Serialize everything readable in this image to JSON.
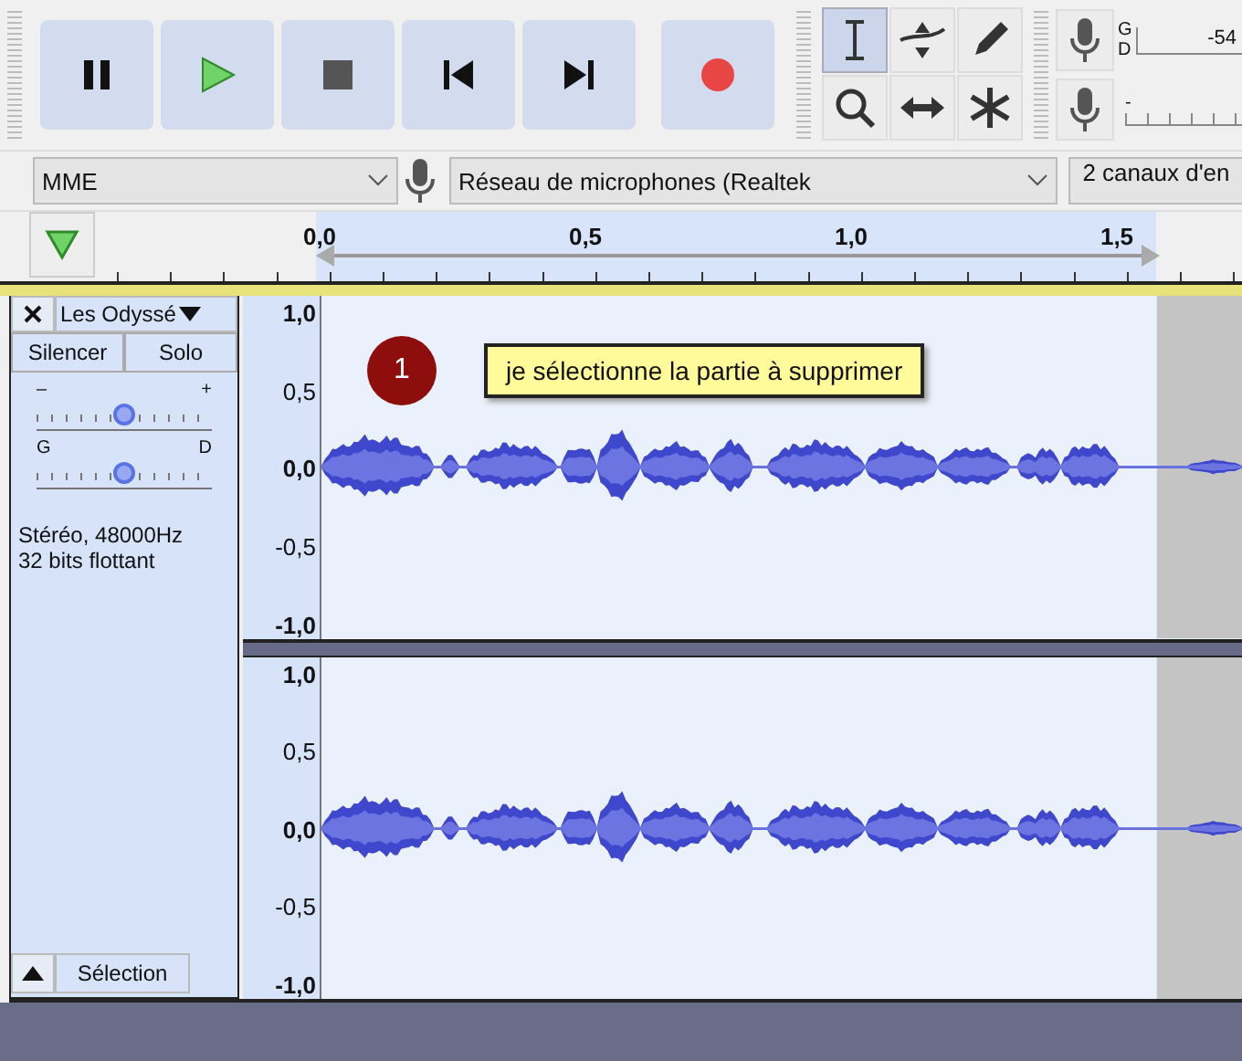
{
  "transport": [
    {
      "kind": "pause"
    },
    {
      "kind": "play"
    },
    {
      "kind": "stop"
    },
    {
      "kind": "skip_start"
    },
    {
      "kind": "skip_end"
    },
    {
      "kind": "record"
    }
  ],
  "tools": [
    {
      "kind": "select",
      "selected": true
    },
    {
      "kind": "envelope",
      "selected": false
    },
    {
      "kind": "draw",
      "selected": false
    },
    {
      "kind": "zoom",
      "selected": false
    },
    {
      "kind": "timeshift",
      "selected": false
    },
    {
      "kind": "multi",
      "selected": false
    }
  ],
  "record_meter": {
    "channel_labels": [
      "G",
      "D"
    ],
    "reading": "-54"
  },
  "play_meter": {
    "reading": "-"
  },
  "devices": {
    "host": "MME",
    "input": "Réseau de microphones (Realtek",
    "channels": "2 canaux d'en"
  },
  "timeline": {
    "labels": [
      "0,0",
      "0,5",
      "1,0",
      "1,5"
    ]
  },
  "track": {
    "name": "Les Odyssé",
    "mute": "Silencer",
    "solo": "Solo",
    "gain": {
      "min": "–",
      "max": "+",
      "level": 0.5
    },
    "pan": {
      "min": "G",
      "max": "D",
      "level": 0.5
    },
    "info": [
      "Stéréo, 48000Hz",
      "32 bits flottant"
    ],
    "collapse": "Sélection"
  },
  "channels": [
    {
      "ruler": [
        "1,0",
        "0,5",
        "0,0",
        "-0,5",
        "-1,0"
      ]
    },
    {
      "ruler": [
        "1,0",
        "0,5",
        "0,0",
        "-0,5",
        "-1,0"
      ]
    }
  ],
  "annotation": {
    "number": "1",
    "text": "je sélectionne la partie à supprimer"
  }
}
